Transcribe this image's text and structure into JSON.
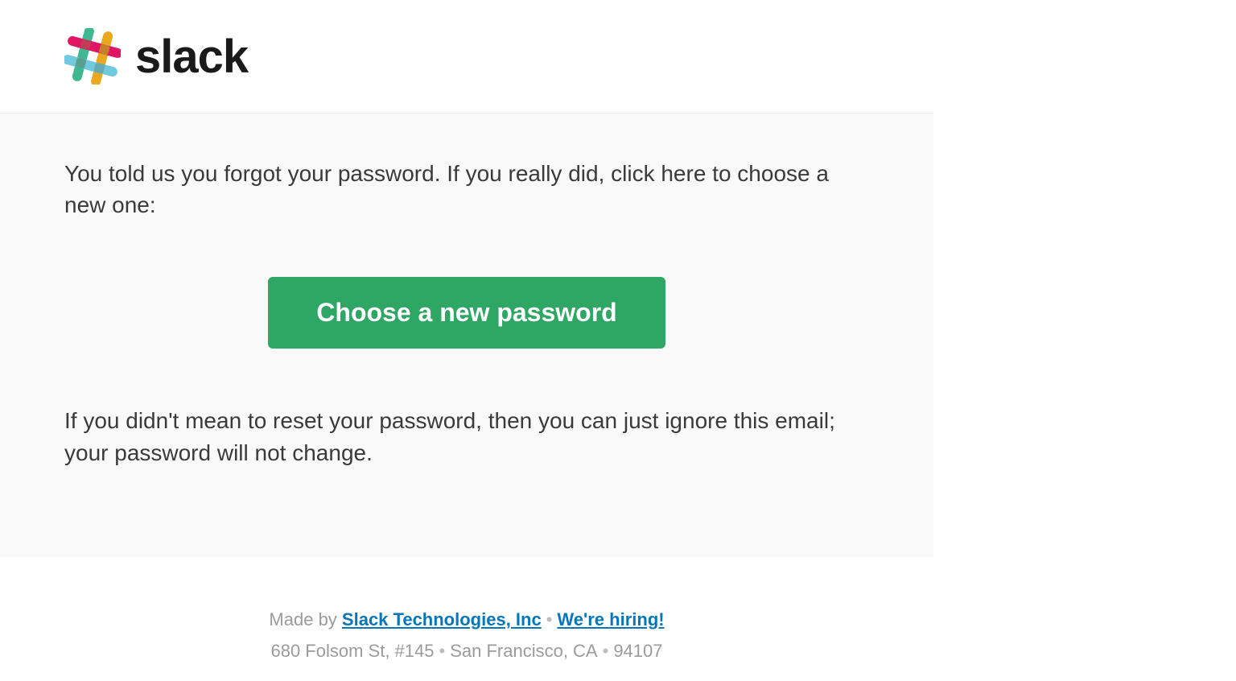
{
  "header": {
    "brand_name": "slack"
  },
  "body": {
    "intro": "You told us you forgot your password. If you really did, click here to choose a new one:",
    "cta_label": "Choose a new password",
    "outro": "If you didn't mean to reset your password, then you can just ignore this email; your password will not change."
  },
  "footer": {
    "made_by_prefix": "Made by ",
    "company_link": "Slack Technologies, Inc",
    "hiring_link": "We're hiring!",
    "address_street": "680 Folsom St, #145",
    "address_city": "San Francisco, CA",
    "address_zip": "94107"
  }
}
